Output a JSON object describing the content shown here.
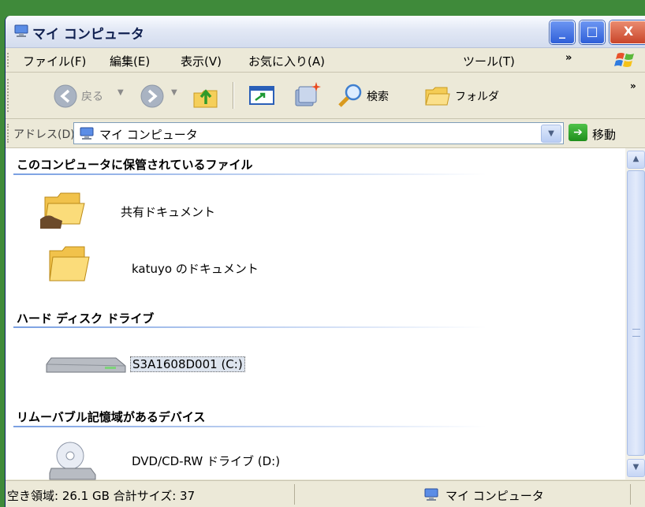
{
  "window": {
    "title": "マイ コンピュータ"
  },
  "window_controls": {
    "minimize": "_",
    "maximize": "□",
    "close": "X"
  },
  "menu": {
    "items": [
      "ファイル(F)",
      "編集(E)",
      "表示(V)",
      "お気に入り(A)",
      "ツール(T)"
    ],
    "more": "»"
  },
  "toolbar": {
    "back_label": "戻る",
    "search_label": "検索",
    "folders_label": "フォルダ",
    "more": "»"
  },
  "address": {
    "label": "アドレス(D)",
    "value": "マイ コンピュータ",
    "go_label": "移動"
  },
  "groups": {
    "stored_files": {
      "heading": "このコンピュータに保管されているファイル",
      "items": [
        "共有ドキュメント",
        "katuyo のドキュメント"
      ]
    },
    "hard_drives": {
      "heading": "ハード ディスク ドライブ",
      "items": [
        "S3A1608D001 (C:)"
      ]
    },
    "removable": {
      "heading": "リムーバブル記憶域があるデバイス",
      "items": [
        "DVD/CD-RW ドライブ (D:)"
      ]
    }
  },
  "statusbar": {
    "left": "空き領域: 26.1 GB 合計サイズ: 37",
    "right": "マイ コンピュータ"
  },
  "colors": {
    "desktop": "#3f8a3a",
    "chrome": "#ece9d8",
    "group_line": "#7aa0e2"
  }
}
